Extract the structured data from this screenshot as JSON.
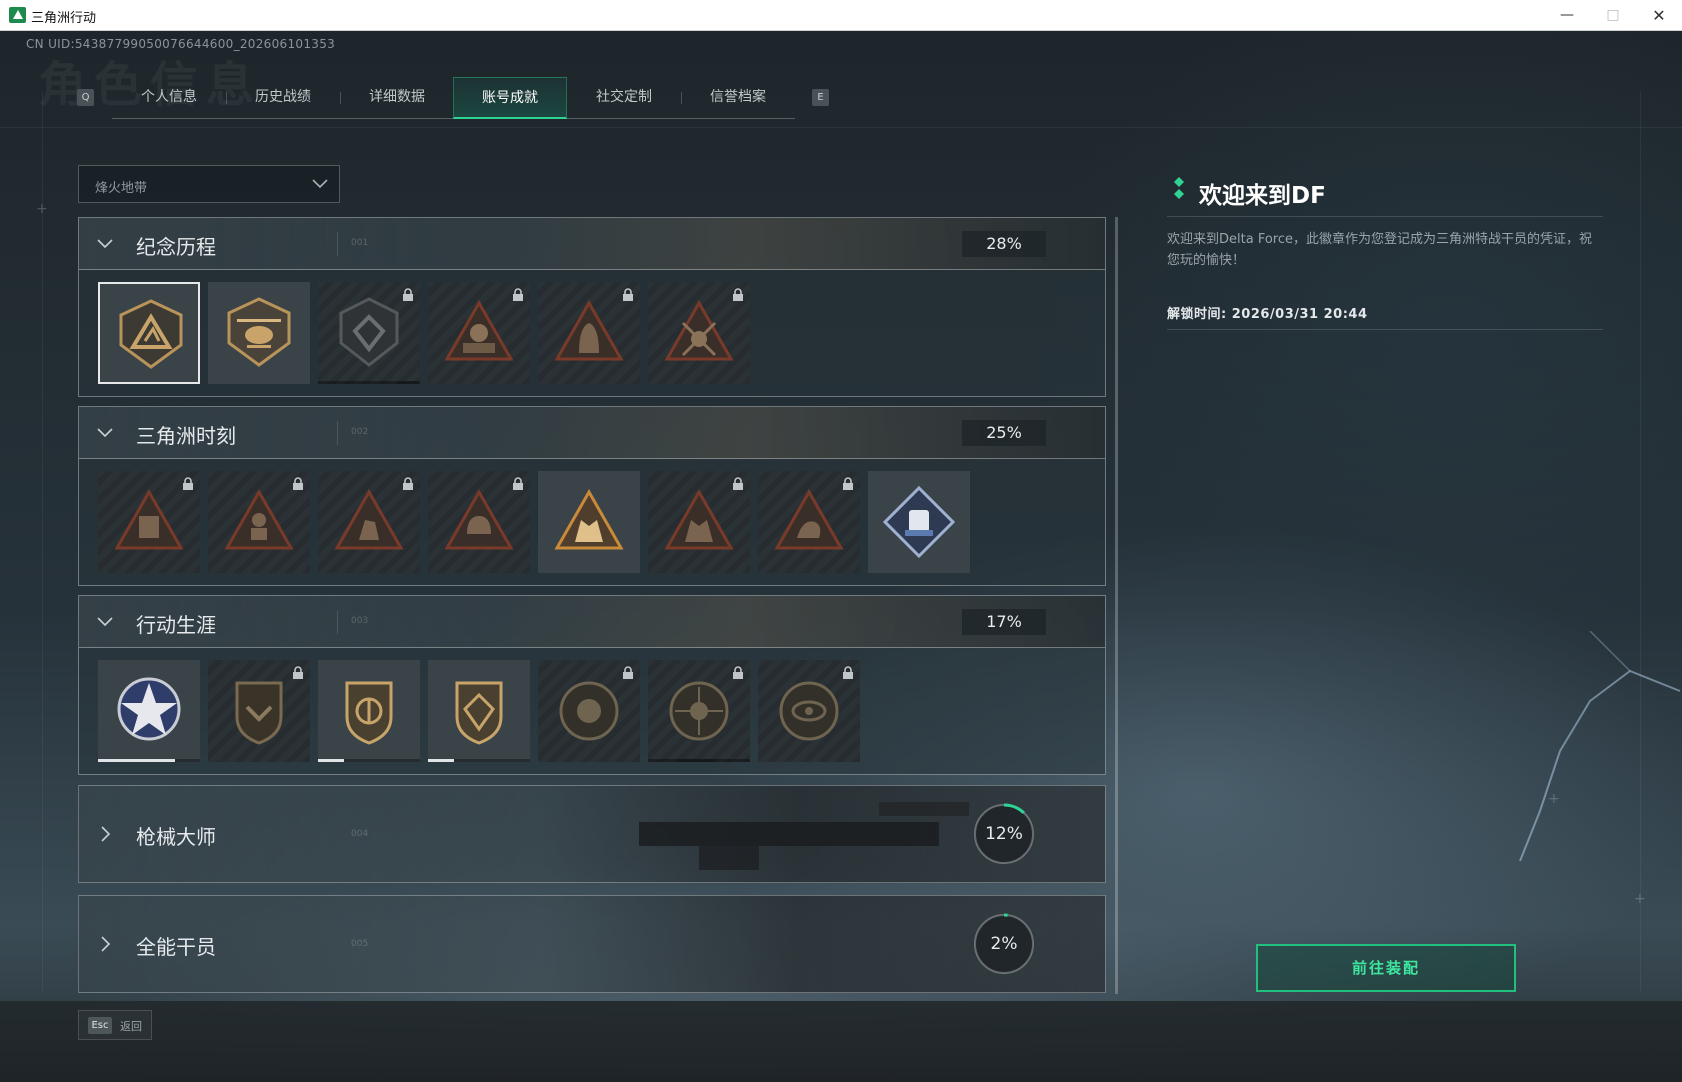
{
  "window": {
    "title": "三角洲行动"
  },
  "uid": "CN UID:543877990500766446​00_202606101353",
  "tabs": {
    "left_key": "Q",
    "right_key": "E",
    "items": [
      {
        "label": "个人信息",
        "active": false
      },
      {
        "label": "历史战绩",
        "active": false
      },
      {
        "label": "详细数据",
        "active": false
      },
      {
        "label": "账号成就",
        "active": true
      },
      {
        "label": "社交定制",
        "active": false
      },
      {
        "label": "信誉档案",
        "active": false
      }
    ]
  },
  "mode_dropdown": {
    "value": "烽火地带"
  },
  "sections": [
    {
      "name": "纪念历程",
      "num": "001",
      "percent": "28%",
      "expanded": true,
      "medals": [
        {
          "icon": "delta-shield-medal",
          "locked": false,
          "selected": true
        },
        {
          "icon": "helicopter-medal",
          "locked": false,
          "selected": false
        },
        {
          "icon": "dark-shield-medal",
          "locked": true,
          "selected": false,
          "progress": 0.18
        },
        {
          "icon": "skull-tank-medal",
          "locked": true,
          "selected": false
        },
        {
          "icon": "hooded-operator-medal",
          "locked": true,
          "selected": false
        },
        {
          "icon": "crossed-swords-skull-medal",
          "locked": true,
          "selected": false
        }
      ]
    },
    {
      "name": "三角洲时刻",
      "num": "002",
      "percent": "25%",
      "expanded": true,
      "medals": [
        {
          "icon": "robot-triangle-medal",
          "locked": true
        },
        {
          "icon": "soldier-triangle-medal",
          "locked": true
        },
        {
          "icon": "crouching-soldier-medal",
          "locked": true
        },
        {
          "icon": "helmet-triangle-medal",
          "locked": true
        },
        {
          "icon": "squad-triangle-gold-medal",
          "locked": false
        },
        {
          "icon": "squad-triangle-dark-medal",
          "locked": true
        },
        {
          "icon": "dragon-triangle-medal",
          "locked": true
        },
        {
          "icon": "diamond-fist-medal",
          "locked": false
        }
      ]
    },
    {
      "name": "行动生涯",
      "num": "003",
      "percent": "17%",
      "expanded": true,
      "medals": [
        {
          "icon": "star-eagle-medal",
          "locked": false,
          "progress": 0.75
        },
        {
          "icon": "wings-shield-medal",
          "locked": true
        },
        {
          "icon": "blades-shield-medal",
          "locked": false,
          "progress": 0.25
        },
        {
          "icon": "crystal-shield-medal",
          "locked": false,
          "progress": 0.25
        },
        {
          "icon": "globe-circle-medal",
          "locked": true
        },
        {
          "icon": "skull-target-medal",
          "locked": true,
          "progress": 0.35
        },
        {
          "icon": "eye-circle-medal",
          "locked": true
        }
      ]
    },
    {
      "name": "枪械大师",
      "num": "004",
      "percent": "12%",
      "percent_value": 0.12,
      "expanded": false
    },
    {
      "name": "全能干员",
      "num": "005",
      "percent": "2%",
      "percent_value": 0.02,
      "expanded": false
    }
  ],
  "detail": {
    "title": "欢迎来到DF",
    "description": "欢迎来到Delta Force，此徽章作为您登记成为三角洲特战干员的凭证，祝您玩的愉快！",
    "unlock_time": "解锁时间: 2026/03/31 20:44",
    "equip_button": "前往装配"
  },
  "footer": {
    "esc_key": "Esc",
    "back_label": "返回"
  },
  "colors": {
    "accent": "#2fd394",
    "button_text": "#3ee6a0",
    "medal_gold": "#b8935a"
  }
}
